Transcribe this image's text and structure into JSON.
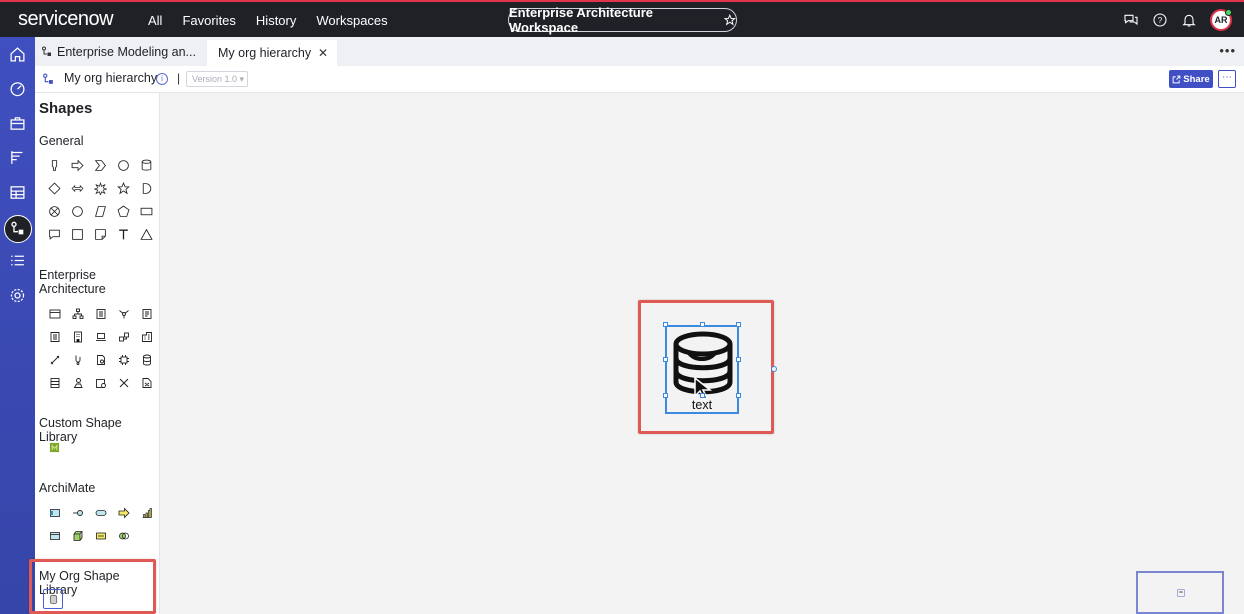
{
  "brand": {
    "logo_text": "servicenow"
  },
  "nav": {
    "all": "All",
    "favorites": "Favorites",
    "history": "History",
    "workspaces": "Workspaces"
  },
  "workspace": {
    "title": "Enterprise Architecture Workspace"
  },
  "user": {
    "initials": "AR"
  },
  "tabs": [
    {
      "label": "Enterprise Modeling an..."
    },
    {
      "label": "My org hierarchy"
    }
  ],
  "diagram": {
    "title": "My org hierarchy",
    "separator": "|",
    "version": "Version 1.0 ▾",
    "share_label": "Share"
  },
  "shapes_panel": {
    "title": "Shapes",
    "sections": [
      {
        "name": "General"
      },
      {
        "name": "Enterprise Architecture"
      },
      {
        "name": "Custom Shape Library"
      },
      {
        "name": "ArchiMate"
      },
      {
        "name": "My Org Shape Library"
      }
    ]
  },
  "canvas": {
    "shape_label": "text"
  },
  "colors": {
    "topbar": "#1f2127",
    "rail": "#3e4eb8",
    "highlight": "#e05a55",
    "selection": "#3a8ae0",
    "share": "#4050c4"
  }
}
